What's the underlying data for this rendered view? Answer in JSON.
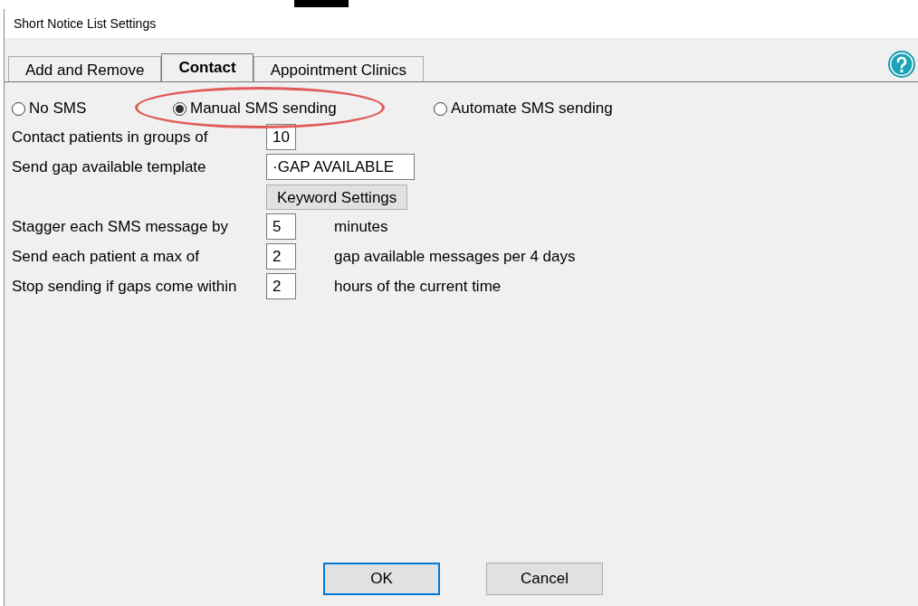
{
  "window": {
    "title": "Short Notice List Settings"
  },
  "tabs": [
    {
      "label": "Add and Remove",
      "selected": false
    },
    {
      "label": "Contact",
      "selected": true
    },
    {
      "label": "Appointment Clinics",
      "selected": false
    }
  ],
  "sms_mode": [
    {
      "label": "No SMS",
      "selected": false,
      "circled": false
    },
    {
      "label": "Manual SMS sending",
      "selected": true,
      "circled": true
    },
    {
      "label": "Automate SMS sending",
      "selected": false,
      "circled": false
    }
  ],
  "settings": [
    {
      "kind": "field",
      "label": "Contact patients in groups of",
      "value": "10"
    },
    {
      "kind": "wide_field",
      "label": "Send gap available template",
      "value": "·GAP AVAILABLE"
    },
    {
      "kind": "button",
      "label": "Keyword Settings"
    },
    {
      "kind": "field",
      "label": "Stagger each SMS message by",
      "value": "5",
      "suffix": "minutes"
    },
    {
      "kind": "field",
      "label": "Send each patient a max of",
      "value": "2",
      "suffix": "gap available messages per 4 days"
    },
    {
      "kind": "field",
      "label": "Stop sending if gaps come within",
      "value": "2",
      "suffix": "hours of the current time"
    }
  ],
  "buttons": [
    {
      "label": "OK",
      "default": true
    },
    {
      "label": "Cancel",
      "default": false
    }
  ]
}
